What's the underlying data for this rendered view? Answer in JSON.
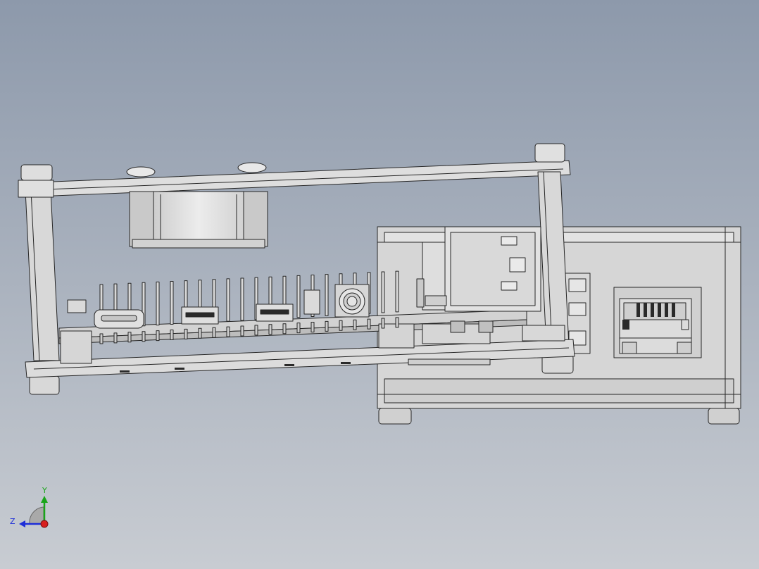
{
  "viewport": {
    "background_top": "#8d99ab",
    "background_bottom": "#c8ccd2",
    "model_fill": "#d5d5d5",
    "model_fill_light": "#e6e6e6",
    "model_fill_dark": "#b4b4b4",
    "edge_color": "#262626"
  },
  "triad": {
    "y_label": "Y",
    "z_label": "Z",
    "y_color": "#19a519",
    "z_color": "#1e2ed8",
    "x_color": "#d81e1e"
  }
}
